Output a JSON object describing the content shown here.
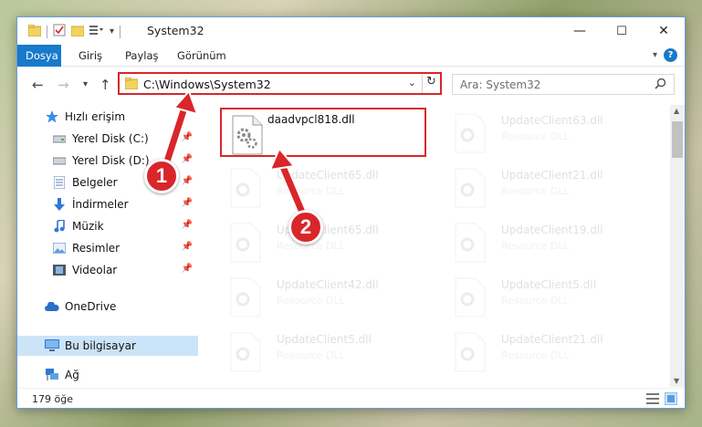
{
  "window": {
    "title": "System32",
    "controls": {
      "minimize": "—",
      "maximize": "☐",
      "close": "✕"
    }
  },
  "ribbon": {
    "tabs": [
      {
        "label": "Dosya",
        "active": true
      },
      {
        "label": "Giriş"
      },
      {
        "label": "Paylaş"
      },
      {
        "label": "Görünüm"
      }
    ],
    "help": "?"
  },
  "navigation": {
    "address": "C:\\Windows\\System32",
    "search_placeholder": "Ara: System32"
  },
  "sidebar": {
    "items": [
      {
        "label": "Hızlı erişim",
        "icon": "star-icon",
        "pinned": false
      },
      {
        "label": "Yerel Disk (C:)",
        "icon": "drive-icon",
        "pinned": true
      },
      {
        "label": "Yerel Disk (D:)",
        "icon": "drive-icon",
        "pinned": true
      },
      {
        "label": "Belgeler",
        "icon": "documents-icon",
        "pinned": true
      },
      {
        "label": "İndirmeler",
        "icon": "download-icon",
        "pinned": true
      },
      {
        "label": "Müzik",
        "icon": "music-icon",
        "pinned": true
      },
      {
        "label": "Resimler",
        "icon": "pictures-icon",
        "pinned": true
      },
      {
        "label": "Videolar",
        "icon": "videos-icon",
        "pinned": true
      },
      {
        "label": "OneDrive",
        "icon": "cloud-icon",
        "pinned": false
      },
      {
        "label": "Bu bilgisayar",
        "icon": "computer-icon",
        "pinned": false,
        "selected": true
      },
      {
        "label": "Ağ",
        "icon": "network-icon",
        "pinned": false
      }
    ]
  },
  "files": [
    {
      "name": "daadvpcl818.dll",
      "type": "",
      "highlighted": true
    },
    {
      "name": "UpdateClient63.dll",
      "type": "Resource DLL"
    },
    {
      "name": "UpdateClient65.dll",
      "type": "Resource DLL"
    },
    {
      "name": "UpdateClient21.dll",
      "type": "Resource DLL"
    },
    {
      "name": "UpdateClient65.dll",
      "type": "Resource DLL"
    },
    {
      "name": "UpdateClient19.dll",
      "type": "Resource DLL"
    },
    {
      "name": "UpdateClient42.dll",
      "type": "Resource DLL"
    },
    {
      "name": "UpdateClient5.dll",
      "type": "Resource DLL"
    },
    {
      "name": "UpdateClient5.dll",
      "type": "Resource DLL"
    },
    {
      "name": "UpdateClient21.dll",
      "type": "Resource DLL"
    }
  ],
  "status": {
    "item_count": "179 öğe"
  },
  "annotations": [
    {
      "label": "1"
    },
    {
      "label": "2"
    }
  ],
  "colors": {
    "accent": "#1979ca",
    "highlight": "#d9262a",
    "selection": "#cce4f7"
  }
}
